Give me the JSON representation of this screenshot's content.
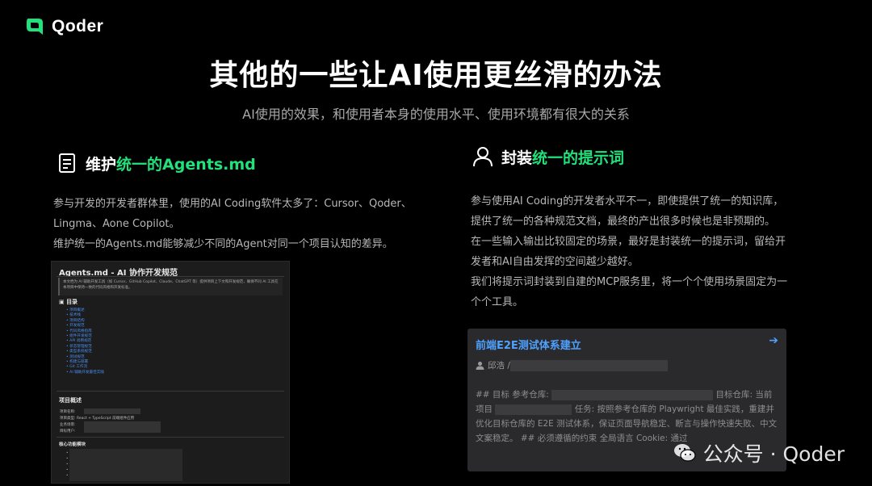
{
  "brand": {
    "name": "Qoder",
    "logo_icon": "qoder-logo-icon",
    "accent": "#22e07a"
  },
  "title": "其他的一些让AI使用更丝滑的办法",
  "subtitle": "AI使用的效果，和使用者本身的使用水平、使用环境都有很大的关系",
  "left": {
    "icon": "document-icon",
    "heading_prefix": "维护",
    "heading_highlight": "统一的Agents.md",
    "paragraphs": [
      "参与开发的开发者群体里，使用的AI Coding软件太多了：Cursor、Qoder、Lingma、Aone Copilot。",
      "维护统一的Agents.md能够减少不同的Agent对同一个项目认知的差异。"
    ],
    "doc": {
      "title": "Agents.md - AI 协作开发规范",
      "note": "本文档为 AI 辅助开发工具（如 Cursor、GitHub Copilot、Claude、ChatGPT 等）提供项目上下文和开发规范，确保不同 AI 工具在本项目中保持一致的代码风格和开发标准。",
      "toc_title": "目录",
      "toc": [
        "项目概述",
        "技术栈",
        "项目结构",
        "开发规范",
        "代码风格指南",
        "组件开发规范",
        "API 调用规范",
        "状态管理规范",
        "类型系统规范",
        "测试规范",
        "构建与部署",
        "Git 工作流",
        "AI 辅助开发最佳实践"
      ],
      "overview_title": "项目概述",
      "overview": [
        "项目名称:",
        "项目类型: React + TypeScript 前端组件应用",
        "业务场景:",
        "目标用户:"
      ],
      "core_title": "核心功能模块"
    }
  },
  "right": {
    "icon": "user-icon",
    "heading_prefix": "封装",
    "heading_highlight": "统一的提示词",
    "paragraphs": [
      "参与使用AI Coding的开发者水平不一，即使提供了统一的知识库，提供了统一的各种规范文档，最终的产出很多时候也是非预期的。",
      "在一些输入输出比较固定的场景，最好是封装统一的提示词，留给开发者和AI自由发挥的空间越少越好。",
      "我们将提示词封装到自建的MCP服务里，将一个个使用场景固定为一个个工具。"
    ],
    "card": {
      "title": "前端E2E测试体系建立",
      "arrow_icon": "arrow-right-icon",
      "author": "邱浩 /",
      "body_1": "## 目标 参考仓库:",
      "body_2": "目标仓库: 当前项目",
      "body_3": "任务: 按照参考仓库的 Playwright 最佳实践，重建并优化目标仓库的 E2E 测试体系，保证页面导航稳定、断言与操作快速失败、中文文案稳定。 ## 必须遵循的约束 全局语言 Cookie: 通过"
    }
  },
  "watermark": {
    "text": "公众号 · Qoder",
    "icon": "wechat-icon"
  }
}
